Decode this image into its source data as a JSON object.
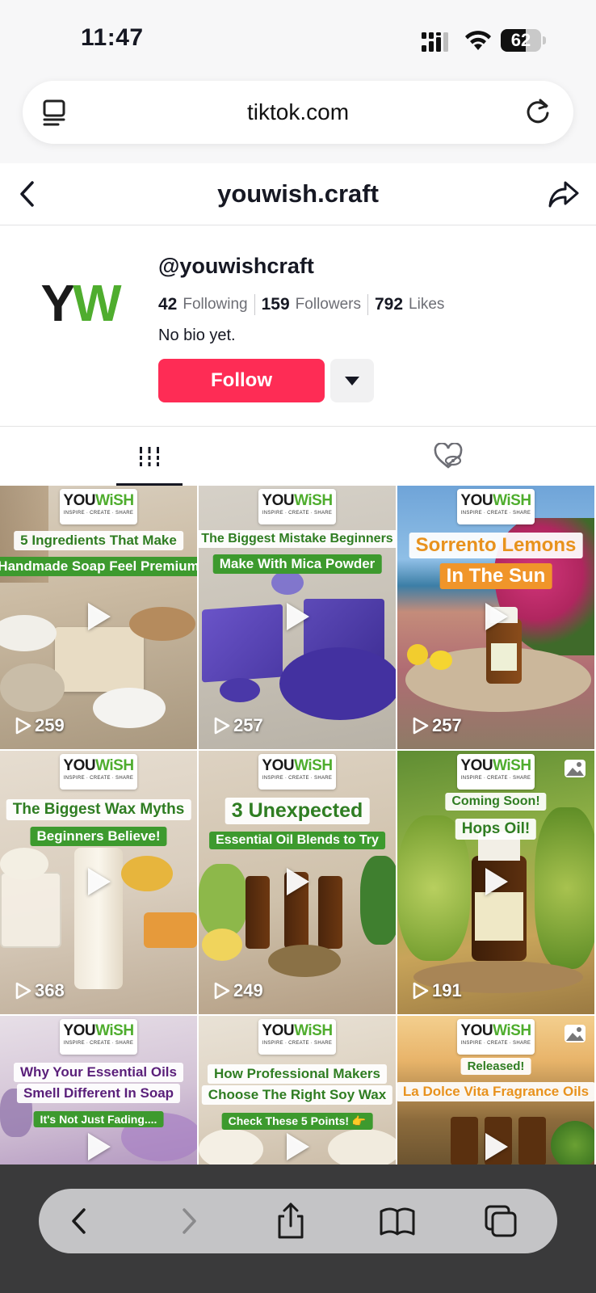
{
  "status_bar": {
    "time": "11:47",
    "battery": "62",
    "battery_level_percent": 62
  },
  "browser": {
    "url": "tiktok.com"
  },
  "header": {
    "title": "youwish.craft"
  },
  "profile": {
    "avatar_text_y": "Y",
    "avatar_text_w": "W",
    "handle": "@youwishcraft",
    "following_count": "42",
    "following_label": "Following",
    "followers_count": "159",
    "followers_label": "Followers",
    "likes_count": "792",
    "likes_label": "Likes",
    "bio": "No bio yet.",
    "follow_label": "Follow"
  },
  "brand_badge": {
    "you": "YOU",
    "wish": "WiSH",
    "tagline": "INSPIRE · CREATE · SHARE"
  },
  "videos": [
    {
      "title_line1": "5 Ingredients That Make",
      "title_line2": "Handmade Soap Feel Premium",
      "views": "259"
    },
    {
      "title_line1": "The Biggest Mistake Beginners",
      "title_line2": "Make With Mica Powder",
      "views": "257"
    },
    {
      "title_line1": "Sorrento Lemons",
      "title_line2": "In The Sun",
      "views": "257"
    },
    {
      "title_line1": "The Biggest Wax Myths",
      "title_line2": "Beginners Believe!",
      "views": "368"
    },
    {
      "title_line1": "3 Unexpected",
      "title_line2": "Essential Oil Blends to Try",
      "views": "249"
    },
    {
      "title_line1": "Coming Soon!",
      "title_line2": "Hops Oil!",
      "views": "191"
    },
    {
      "title_line1": "Why Your Essential Oils",
      "title_line2": "Smell Different In Soap",
      "title_line3": "It's Not Just Fading....",
      "views": ""
    },
    {
      "title_line1": "How Professional Makers",
      "title_line2": "Choose The Right Soy Wax",
      "title_line3": "Check These 5 Points! 👉",
      "views": ""
    },
    {
      "title_line1": "Released!",
      "title_line2": "La Dolce Vita Fragrance Oils",
      "views": ""
    }
  ],
  "colors": {
    "follow": "#fe2c55",
    "brand_green": "#4fad2e",
    "toolbar": "#3a3a3b"
  },
  "icons": [
    "tab-overview-icon",
    "reload-icon",
    "back-icon",
    "share-icon",
    "videos-grid-icon",
    "liked-hidden-icon",
    "play-icon",
    "photo-icon",
    "toolbar-back-icon",
    "toolbar-forward-icon",
    "toolbar-share-icon",
    "bookmarks-icon",
    "tabs-icon"
  ]
}
